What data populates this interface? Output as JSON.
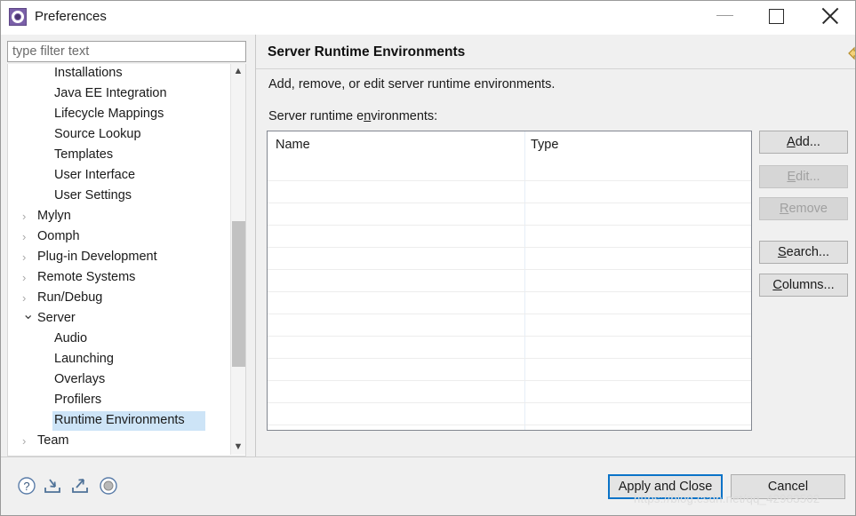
{
  "window": {
    "title": "Preferences",
    "icon": "preferences-gear-icon",
    "controls": {
      "minimize": "minimize-icon",
      "maximize": "maximize-icon",
      "close": "close-icon"
    }
  },
  "filter": {
    "placeholder": "type filter text",
    "value": ""
  },
  "tree": {
    "items": [
      {
        "label": "Installations",
        "level": 2,
        "expander": "",
        "selected": false
      },
      {
        "label": "Java EE Integration",
        "level": 2,
        "expander": "",
        "selected": false
      },
      {
        "label": "Lifecycle Mappings",
        "level": 2,
        "expander": "",
        "selected": false
      },
      {
        "label": "Source Lookup",
        "level": 2,
        "expander": "",
        "selected": false
      },
      {
        "label": "Templates",
        "level": 2,
        "expander": "",
        "selected": false
      },
      {
        "label": "User Interface",
        "level": 2,
        "expander": "",
        "selected": false
      },
      {
        "label": "User Settings",
        "level": 2,
        "expander": "",
        "selected": false
      },
      {
        "label": "Mylyn",
        "level": 1,
        "expander": "collapsed",
        "selected": false
      },
      {
        "label": "Oomph",
        "level": 1,
        "expander": "collapsed",
        "selected": false
      },
      {
        "label": "Plug-in Development",
        "level": 1,
        "expander": "collapsed",
        "selected": false
      },
      {
        "label": "Remote Systems",
        "level": 1,
        "expander": "collapsed",
        "selected": false
      },
      {
        "label": "Run/Debug",
        "level": 1,
        "expander": "collapsed",
        "selected": false
      },
      {
        "label": "Server",
        "level": 1,
        "expander": "expanded",
        "selected": false
      },
      {
        "label": "Audio",
        "level": 2,
        "expander": "",
        "selected": false
      },
      {
        "label": "Launching",
        "level": 2,
        "expander": "",
        "selected": false
      },
      {
        "label": "Overlays",
        "level": 2,
        "expander": "",
        "selected": false
      },
      {
        "label": "Profilers",
        "level": 2,
        "expander": "",
        "selected": false
      },
      {
        "label": "Runtime Environments",
        "level": 2,
        "expander": "",
        "selected": true
      },
      {
        "label": "Team",
        "level": 1,
        "expander": "collapsed",
        "selected": false
      }
    ],
    "selection_color": "#cde4f7",
    "annotation_color": "#f5272a"
  },
  "page": {
    "title": "Server Runtime Environments",
    "description": "Add, remove, or edit server runtime environments.",
    "list_label_pre": "Server runtime e",
    "list_label_mnemonic": "n",
    "list_label_post": "vironments:",
    "nav": {
      "back": "back-arrow-icon",
      "back_dropdown": "back-dropdown-icon",
      "forward": "forward-arrow-icon",
      "forward_dropdown": "forward-dropdown-icon",
      "menu_dropdown": "view-menu-icon",
      "back_color": "#e8b63a",
      "forward_color": "#c9c9c9"
    }
  },
  "table": {
    "columns": [
      "Name",
      "Type"
    ],
    "rows": []
  },
  "buttons": {
    "side": [
      {
        "pre": "",
        "mnemonic": "A",
        "post": "dd...",
        "enabled": true,
        "name": "add-button"
      },
      {
        "pre": "",
        "mnemonic": "E",
        "post": "dit...",
        "enabled": false,
        "name": "edit-button"
      },
      {
        "pre": "",
        "mnemonic": "R",
        "post": "emove",
        "enabled": false,
        "name": "remove-button"
      },
      {
        "pre": "",
        "mnemonic": "S",
        "post": "earch...",
        "enabled": true,
        "name": "search-button"
      },
      {
        "pre": "",
        "mnemonic": "C",
        "post": "olumns...",
        "enabled": true,
        "name": "columns-button"
      }
    ],
    "apply_and_close": "Apply and Close",
    "cancel": "Cancel"
  },
  "bottom_icons": [
    {
      "name": "help-icon"
    },
    {
      "name": "import-icon"
    },
    {
      "name": "export-icon"
    },
    {
      "name": "restore-defaults-icon"
    }
  ],
  "watermark": "https://blog.csdn.net/qq_42983502"
}
